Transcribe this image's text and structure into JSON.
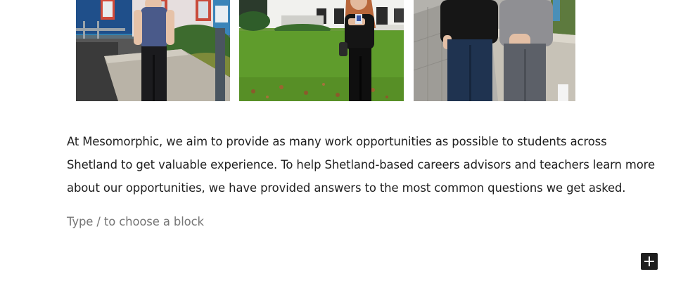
{
  "gallery": {
    "images": [
      {
        "alt": "Student standing outside a colourful building"
      },
      {
        "alt": "Student holding an award on a lawn"
      },
      {
        "alt": "Two students standing beside a stone wall"
      }
    ]
  },
  "content": {
    "paragraph": "At Mesomorphic, we aim to provide as many work opportunities as possible to students across Shetland to get valuable experience. To help Shetland-based careers advisors and teachers learn more about our opportunities, we have provided answers to the most common questions we get asked.",
    "block_placeholder": "Type / to choose a block"
  },
  "toolbar": {
    "add_block_icon": "plus-icon",
    "add_block_color": "#1e1e1e"
  }
}
